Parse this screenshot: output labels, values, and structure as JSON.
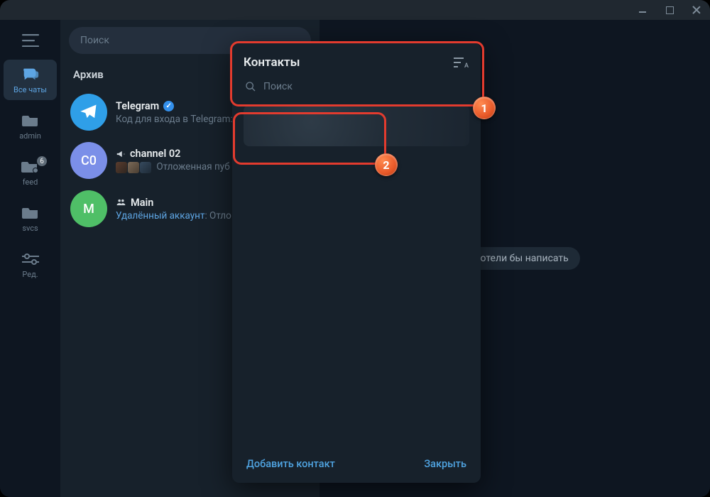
{
  "titlebar": {
    "minimize": "–",
    "maximize": "□",
    "close": "×"
  },
  "rail": {
    "items": [
      {
        "label": "Все чаты",
        "icon": "chats"
      },
      {
        "label": "admin",
        "icon": "folder"
      },
      {
        "label": "feed",
        "icon": "folder-dot",
        "badge": "6"
      },
      {
        "label": "svcs",
        "icon": "folder"
      },
      {
        "label": "Ред.",
        "icon": "sliders"
      }
    ]
  },
  "search": {
    "placeholder": "Поиск"
  },
  "chatcol": {
    "section": "Архив",
    "chats": [
      {
        "name": "Telegram",
        "verified": true,
        "sub": "Код для входа в Telegram:",
        "avatar": "tg",
        "color": "#2f9fe8"
      },
      {
        "name": "channel 02",
        "prefix_icon": "megaphone",
        "sub": "Отложенная пуб",
        "avatar": "C0",
        "color": "#7b8fe8",
        "thumbs": true
      },
      {
        "name": "Main",
        "prefix_icon": "group",
        "sub_link": "Удалённый аккаунт",
        "sub_rest": ": Отло",
        "avatar": "M",
        "color": "#4fbf67"
      }
    ]
  },
  "main": {
    "placeholder_tail": "му хотели бы написать"
  },
  "modal": {
    "title": "Контакты",
    "search_placeholder": "Поиск",
    "add_contact": "Добавить контакт",
    "close": "Закрыть"
  },
  "callouts": {
    "one": "1",
    "two": "2"
  }
}
